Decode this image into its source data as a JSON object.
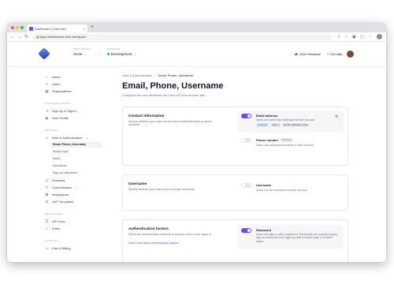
{
  "browser": {
    "tab_title": "Dashboard | Clerk.dev",
    "tab_close": "×",
    "new_tab": "+",
    "back": "←",
    "forward": "→",
    "reload": "↻",
    "url": "https://dashboard.clerk.dev/apps/",
    "url_lock": "🔒",
    "toolbar_icons": [
      "⇪",
      "☆",
      "▣",
      "▢",
      "⋮"
    ]
  },
  "topnav": {
    "application_label": "APPLICATION",
    "application_value": "Acme",
    "instance_label": "INSTANCE",
    "instance_value": "Development",
    "separator": "/",
    "chevron": "⌄",
    "feedback": "Give Feedback",
    "feedback_icon": "📣",
    "help": "Get help",
    "help_icon": "?"
  },
  "sidebar": {
    "items_top": [
      {
        "label": "Home",
        "icon": "⌂"
      },
      {
        "label": "Users",
        "icon": "☺"
      },
      {
        "label": "Organizations",
        "icon": "▦"
      }
    ],
    "section_customer": "CUSTOMER-FACING",
    "items_customer": [
      {
        "label": "Sign Up & Sign In",
        "icon": "⇥"
      },
      {
        "label": "User Profile",
        "icon": "◉"
      }
    ],
    "section_settings": "SETTINGS",
    "settings_group": {
      "label": "User & Authentication",
      "icon": "☺",
      "chevron": "⌄"
    },
    "settings_subitems": [
      "Email, Phone, Username",
      "Social Login",
      "Web3",
      "Multi-factor",
      "Sign-up restrictions"
    ],
    "items_settings": [
      {
        "label": "Sessions",
        "icon": "◷"
      },
      {
        "label": "Customization",
        "icon": "✎",
        "chevron": "›"
      },
      {
        "label": "Integrations",
        "icon": "⧉"
      },
      {
        "label": "JWT Templates",
        "icon": "⊡"
      }
    ],
    "section_developers": "DEVELOPERS",
    "items_developers": [
      {
        "label": "API Keys",
        "icon": "⚿"
      },
      {
        "label": "Paths",
        "icon": "⑂"
      }
    ],
    "section_account": "ACCOUNT",
    "items_account": [
      {
        "label": "Plan & Billing",
        "icon": "▭"
      }
    ]
  },
  "main": {
    "breadcrumb_parent": "User & Authentication",
    "breadcrumb_sep": "/",
    "breadcrumb_current": "Email, Phone, Username",
    "title": "Email, Phone, Username",
    "subtitle": "Configure the user attributes the Clerk API should work with",
    "card_contact": {
      "title": "Contact information",
      "description": "Specify whether your users should have email addresses or phone numbers",
      "email": {
        "label": "Email address",
        "description": "Users can add email addresses to their account",
        "enabled": true,
        "chips": [
          "Required",
          "Sign in",
          "Email verification code"
        ],
        "gear_icon": "⚙"
      },
      "phone": {
        "label": "Phone number",
        "badge": "Premium",
        "description": "Users can add phone numbers to their account",
        "enabled": false
      }
    },
    "card_username": {
      "title": "Username",
      "description": "Specify whether your users have a unique username",
      "option": {
        "label": "Username",
        "description": "Users can set usernames to their account",
        "enabled": false
      }
    },
    "card_auth": {
      "title": "Authentication factors",
      "description": "Select the authentication methods to present when a user signs in",
      "link": "Learn more about authentication factors",
      "option": {
        "label": "Password",
        "description": "Users can sign in with a password. Passwords are required during sign up unless the user signs up with a Social Login or a Web3 wallet.",
        "enabled": true
      }
    }
  },
  "colors": {
    "accent": "#6c47ff",
    "chip_required_bg": "#dbeafe",
    "chip_required_fg": "#2563eb",
    "chip_bg": "#e5e7eb",
    "chip_fg": "#374151"
  }
}
